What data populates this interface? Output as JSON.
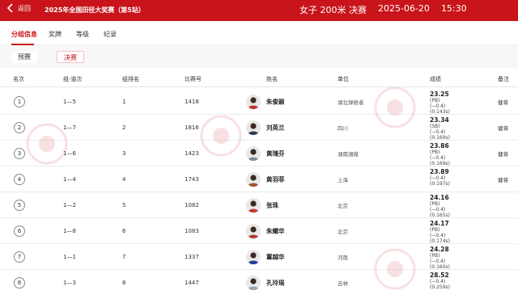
{
  "topbar": {
    "back_label": "返回",
    "event_title": "2025年全国田径大奖赛（第5站）",
    "race_title": "女子 200米 决赛",
    "date": "2025-06-20",
    "time": "15:30",
    "background_color": "#c8141a"
  },
  "tabs": [
    {
      "label": "分组信息",
      "active": true
    },
    {
      "label": "奖牌",
      "active": false
    },
    {
      "label": "等级",
      "active": false
    },
    {
      "label": "纪录",
      "active": false
    }
  ],
  "subtabs": [
    {
      "label": "预赛",
      "active": false
    },
    {
      "label": "决赛",
      "active": true
    }
  ],
  "columns": {
    "rank": "名次",
    "heat_lane": "组-道次",
    "heat_rank": "组排名",
    "bib": "比赛号",
    "name": "姓名",
    "unit": "单位",
    "result": "成绩",
    "remark": "备注"
  },
  "rows": [
    {
      "rank": "1",
      "heat_lane": "1—5",
      "heat_rank": "1",
      "bib": "1418",
      "name": "朱俊颖",
      "unit": "湖北弹射者",
      "time": "23.25",
      "tag": "(PB)",
      "wind": "(−0.4)",
      "reaction": "(0.143s)",
      "remark": "健将",
      "avatar_color": "#c0392b"
    },
    {
      "rank": "2",
      "heat_lane": "1—7",
      "heat_rank": "2",
      "bib": "1816",
      "name": "刘英兰",
      "unit": "四川",
      "time": "23.34",
      "tag": "(SB)",
      "wind": "(−0.4)",
      "reaction": "(0.169s)",
      "remark": "健将",
      "avatar_color": "#2c3e50"
    },
    {
      "rank": "3",
      "heat_lane": "1—6",
      "heat_rank": "3",
      "bib": "1423",
      "name": "黄瑰芬",
      "unit": "湖南湘媒",
      "time": "23.86",
      "tag": "(PB)",
      "wind": "(−0.4)",
      "reaction": "(0.169s)",
      "remark": "健将",
      "avatar_color": "#7f8c8d"
    },
    {
      "rank": "4",
      "heat_lane": "1—4",
      "heat_rank": "4",
      "bib": "1743",
      "name": "黄羽菲",
      "unit": "上海",
      "time": "23.89",
      "tag": "",
      "wind": "(−0.4)",
      "reaction": "(0.197s)",
      "remark": "健将",
      "avatar_color": "#a0522d"
    },
    {
      "rank": "5",
      "heat_lane": "1—2",
      "heat_rank": "5",
      "bib": "1082",
      "name": "张珠",
      "unit": "北京",
      "time": "24.16",
      "tag": "(PB)",
      "wind": "(−0.4)",
      "reaction": "(0.165s)",
      "remark": "",
      "avatar_color": "#c0392b"
    },
    {
      "rank": "6",
      "heat_lane": "1—8",
      "heat_rank": "6",
      "bib": "1083",
      "name": "朱耀华",
      "unit": "北京",
      "time": "24.17",
      "tag": "(PB)",
      "wind": "(−0.4)",
      "reaction": "(0.174s)",
      "remark": "",
      "avatar_color": "#b03a2e"
    },
    {
      "rank": "7",
      "heat_lane": "1—1",
      "heat_rank": "7",
      "bib": "1337",
      "name": "董越华",
      "unit": "河南",
      "time": "24.28",
      "tag": "(PB)",
      "wind": "(−0.4)",
      "reaction": "(0.160s)",
      "remark": "",
      "avatar_color": "#1f3a93"
    },
    {
      "rank": "8",
      "heat_lane": "1—3",
      "heat_rank": "8",
      "bib": "1447",
      "name": "孔玲瑶",
      "unit": "吉林",
      "time": "28.52",
      "tag": "",
      "wind": "(−0.4)",
      "reaction": "(0.259s)",
      "remark": "",
      "avatar_color": "#95a5a6"
    }
  ]
}
